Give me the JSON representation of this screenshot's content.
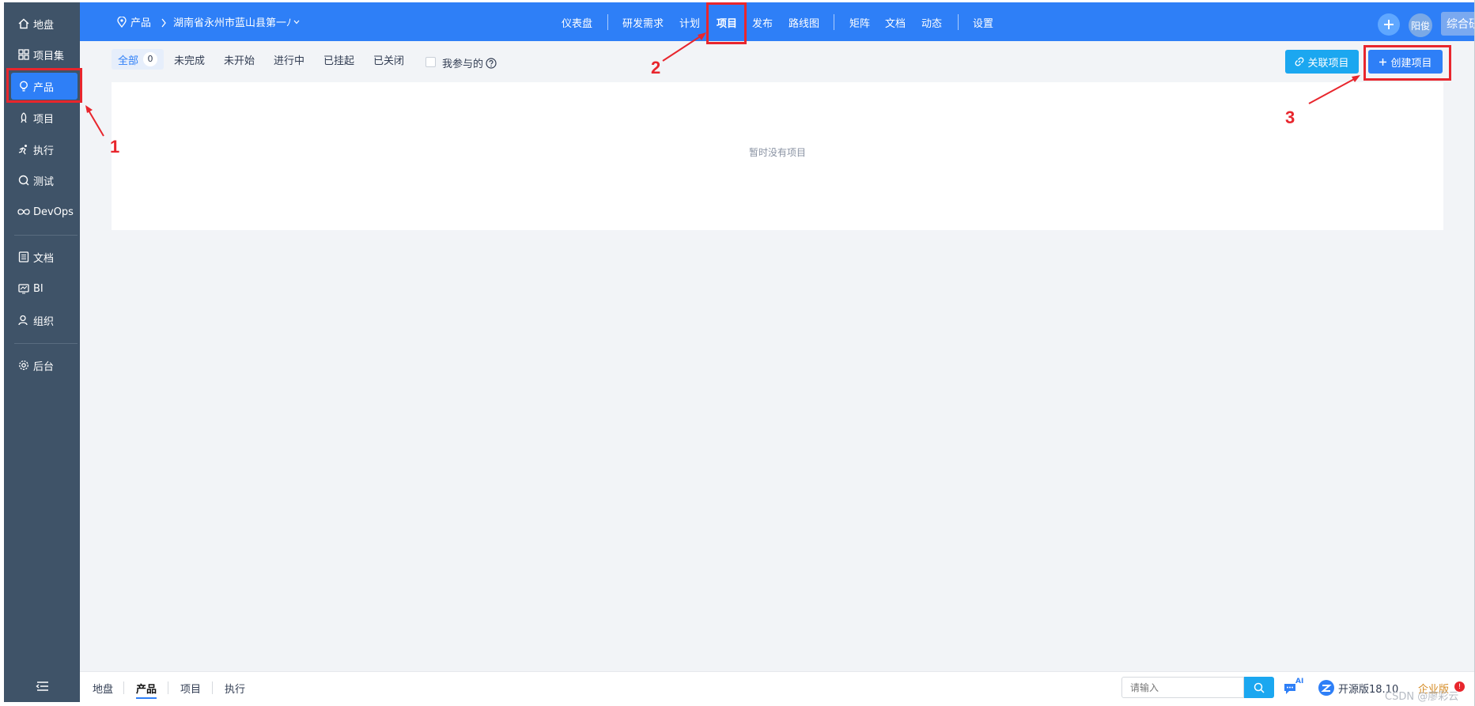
{
  "sidebar": {
    "items": [
      {
        "label": "地盘"
      },
      {
        "label": "项目集"
      },
      {
        "label": "产品"
      },
      {
        "label": "项目"
      },
      {
        "label": "执行"
      },
      {
        "label": "测试"
      },
      {
        "label": "DevOps"
      },
      {
        "label": "文档"
      },
      {
        "label": "BI"
      },
      {
        "label": "组织"
      },
      {
        "label": "后台"
      }
    ]
  },
  "header": {
    "module": "产品",
    "product_name": "湖南省永州市蓝山县第一ﾉ",
    "nav": {
      "dashboard": "仪表盘",
      "requirements": "研发需求",
      "plan": "计划",
      "project": "项目",
      "release": "发布",
      "roadmap": "路线图",
      "matrix": "矩阵",
      "doc": "文档",
      "dynamic": "动态",
      "settings": "设置"
    },
    "user": "阳俊",
    "switch_label": "综合研发界面"
  },
  "filters": {
    "all": "全部",
    "all_count": "0",
    "undone": "未完成",
    "not_started": "未开始",
    "doing": "进行中",
    "suspended": "已挂起",
    "closed": "已关闭",
    "involved": "我参与的"
  },
  "actions": {
    "link_project": "关联项目",
    "create_project": "创建项目"
  },
  "empty_message": "暂时没有项目",
  "annotations": {
    "n1": "1",
    "n2": "2",
    "n3": "3"
  },
  "footer": {
    "items": {
      "dashboard": "地盘",
      "product": "产品",
      "project": "项目",
      "execution": "执行"
    },
    "search_placeholder": "请输入",
    "ai_label": "AI",
    "version": "开源版18.10",
    "enterprise": "企业版",
    "enterprise_badge": "!",
    "watermark": "CSDN @廖彩云"
  },
  "colors": {
    "primary": "#2e7ff7",
    "sidebar_bg": "#3f5368",
    "annotation": "#e8262d",
    "accent_cyan": "#1ba7f0"
  }
}
